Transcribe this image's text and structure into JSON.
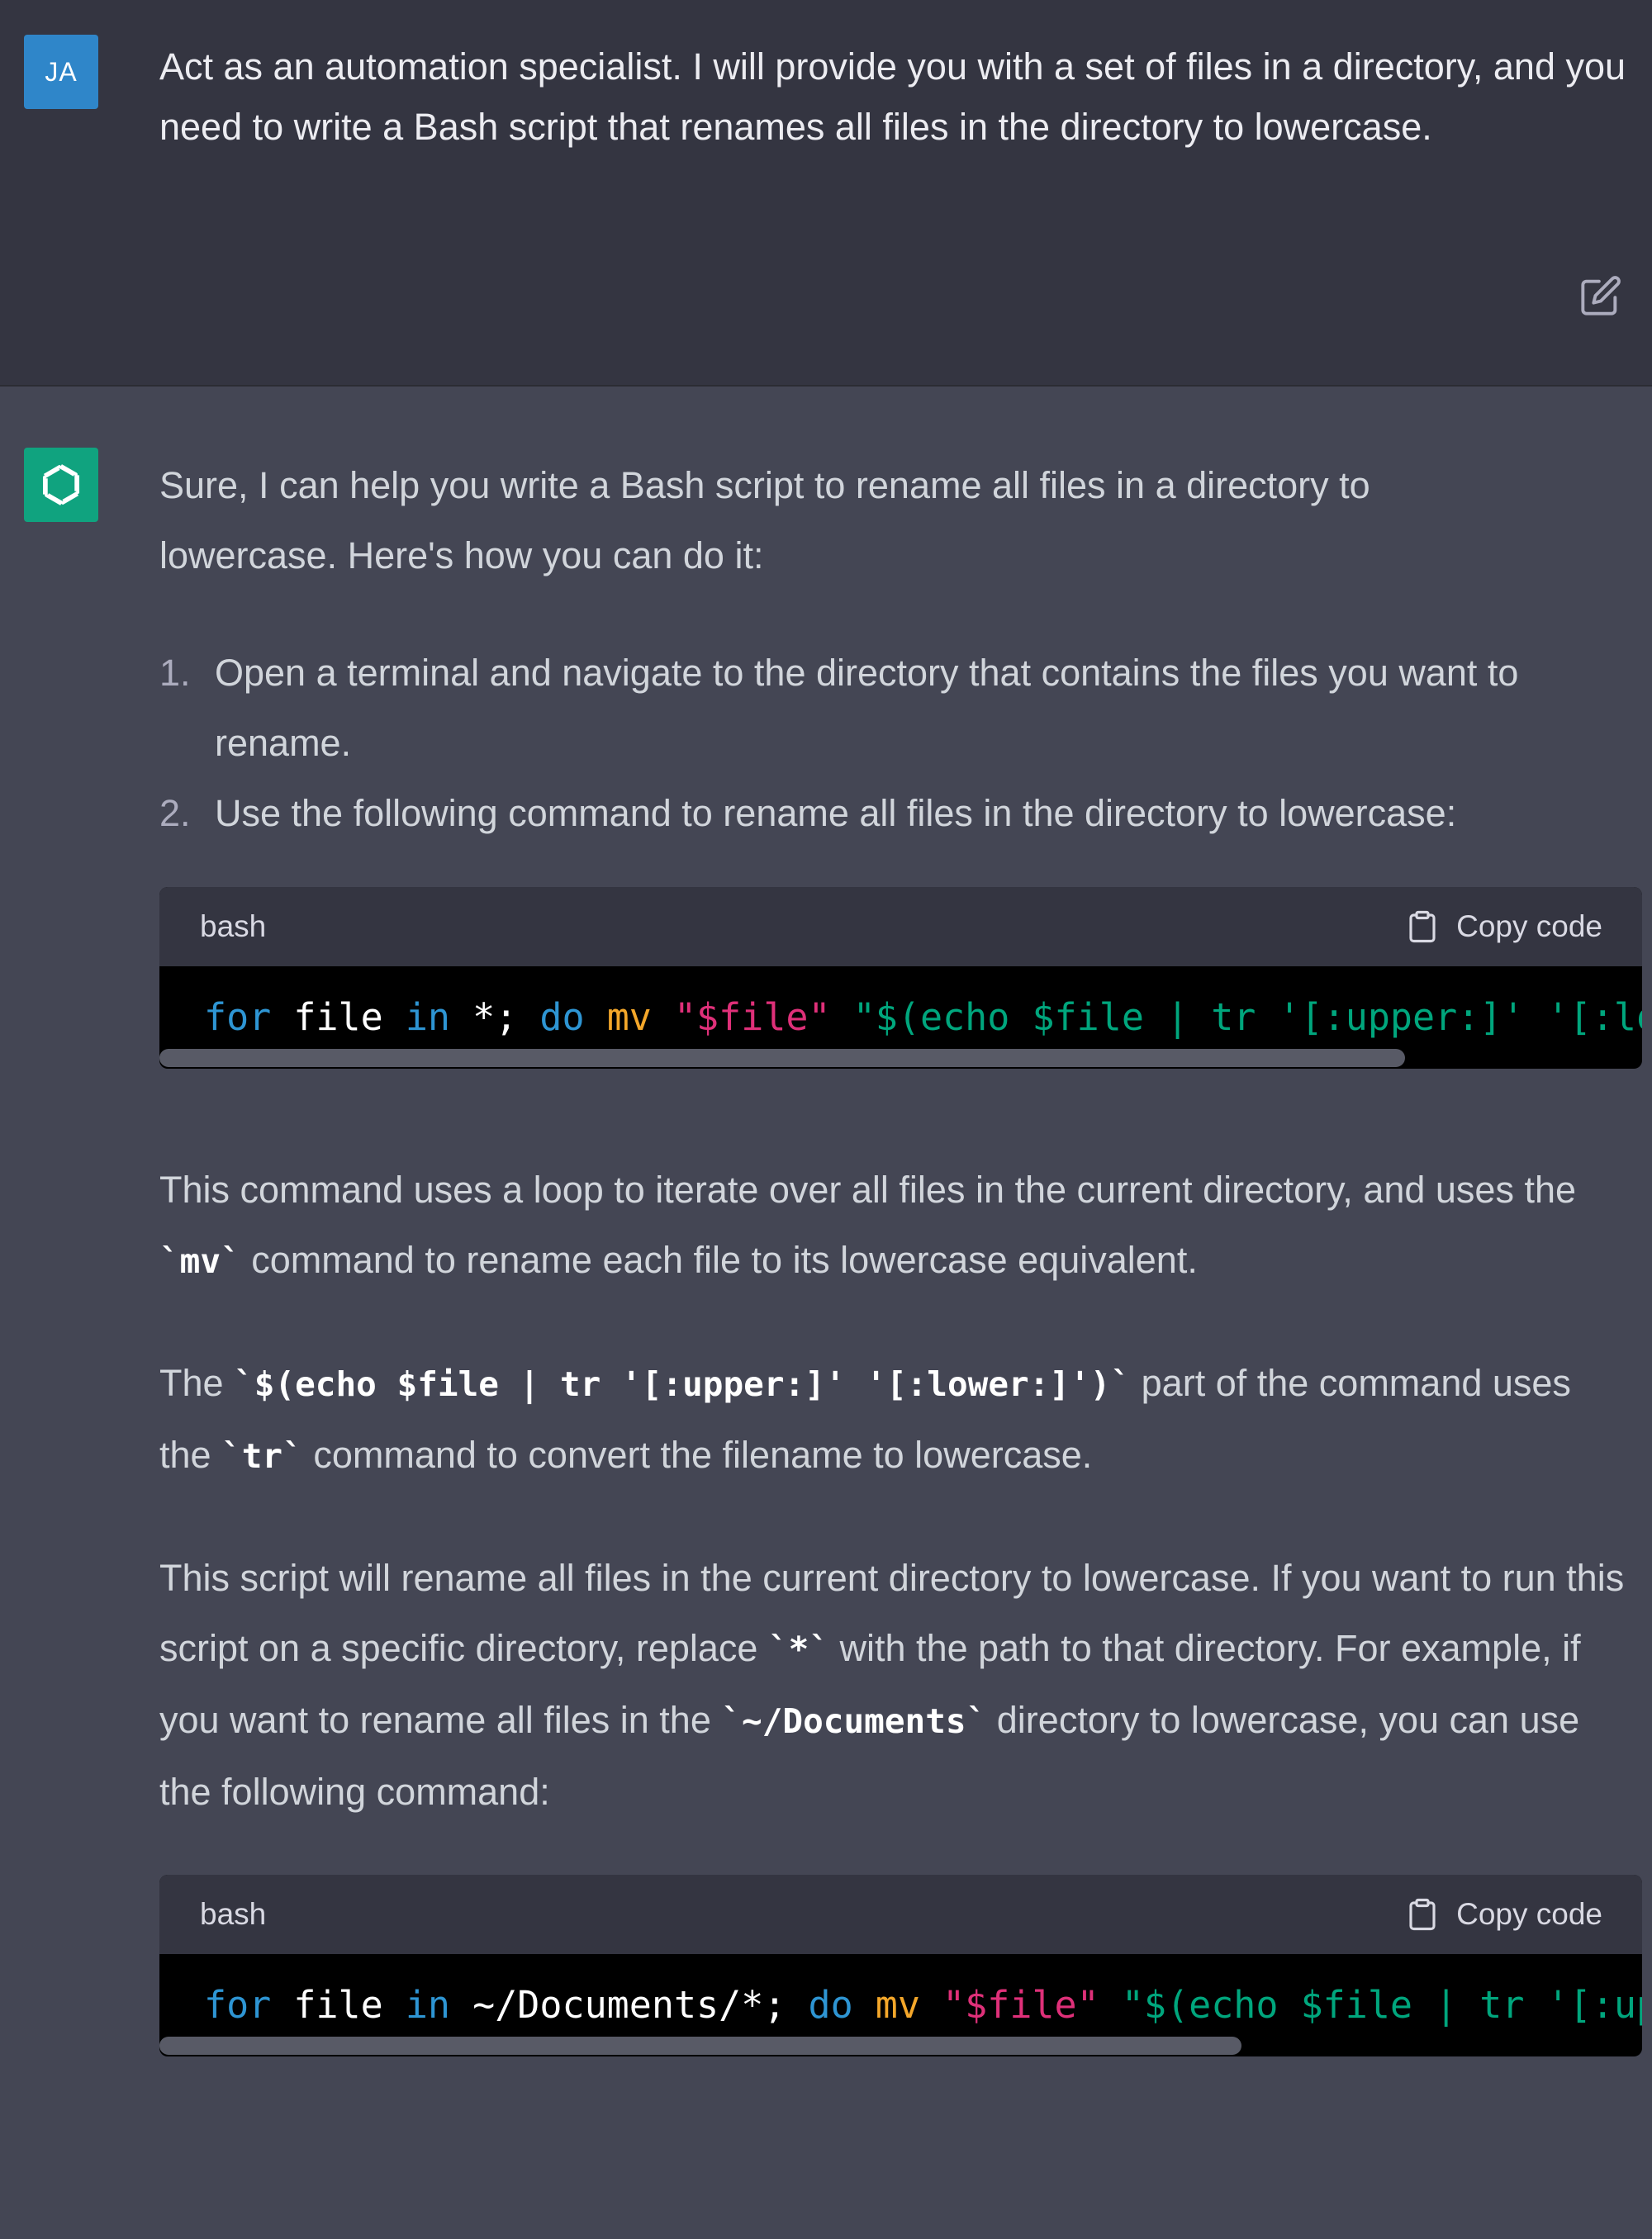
{
  "user_message": {
    "avatar_initials": "JA",
    "text": "Act as an automation specialist. I will provide you with a set of files in a directory, and you need to write a Bash script that renames all files in the directory to lowercase.",
    "edit_icon": "edit-icon"
  },
  "assistant_message": {
    "avatar_icon": "openai-logo-icon",
    "intro": "Sure, I can help you write a Bash script to rename all files in a directory to lowercase. Here's how you can do it:",
    "steps": [
      {
        "num": "1.",
        "text": "Open a terminal and navigate to the directory that contains the files you want to rename."
      },
      {
        "num": "2.",
        "text": "Use the following command to rename all files in the directory to lowercase:"
      }
    ],
    "code_blocks": [
      {
        "language": "bash",
        "copy_label": "Copy code",
        "tokens": [
          "for",
          " file ",
          "in",
          " *; ",
          "do",
          " ",
          "mv",
          " ",
          "\"$file\"",
          " ",
          "\"$(echo $file | tr '[:upper:]' '[:lower"
        ],
        "scroll_fraction": 0.84
      },
      {
        "language": "bash",
        "copy_label": "Copy code",
        "tokens": [
          "for",
          " file ",
          "in",
          " ~/Documents/*; ",
          "do",
          " ",
          "mv",
          " ",
          "\"$file\"",
          " ",
          "\"$(echo $file | tr '[:upper"
        ],
        "scroll_fraction": 0.73
      }
    ],
    "para_mv": {
      "a": "This command uses a loop to iterate over all files in the current directory, and uses the ",
      "code": "`mv`",
      "b": " command to rename each file to its lowercase equivalent."
    },
    "para_tr": {
      "a": "The ",
      "code1": "`$(echo $file | tr '[:upper:]' '[:lower:]')`",
      "b": " part of the command uses the ",
      "code2": "`tr`",
      "c": " command to convert the filename to lowercase."
    },
    "para_dir": {
      "a": "This script will rename all files in the current directory to lowercase. If you want to run this script on a specific directory, replace ",
      "code1": "`*`",
      "b": " with the path to that directory. For example, if you want to rename all files in the ",
      "code2": "`~/Documents`",
      "c": " directory to lowercase, you can use the following command:"
    }
  },
  "colors": {
    "user_bg": "#343541",
    "assistant_bg": "#444654",
    "code_bg": "#000000",
    "keyword": "#2e95d3",
    "builtin": "#f4a72a",
    "string": "#00a67d",
    "variable": "#df3079",
    "user_avatar": "#2f86c9",
    "bot_avatar": "#10a37f"
  }
}
